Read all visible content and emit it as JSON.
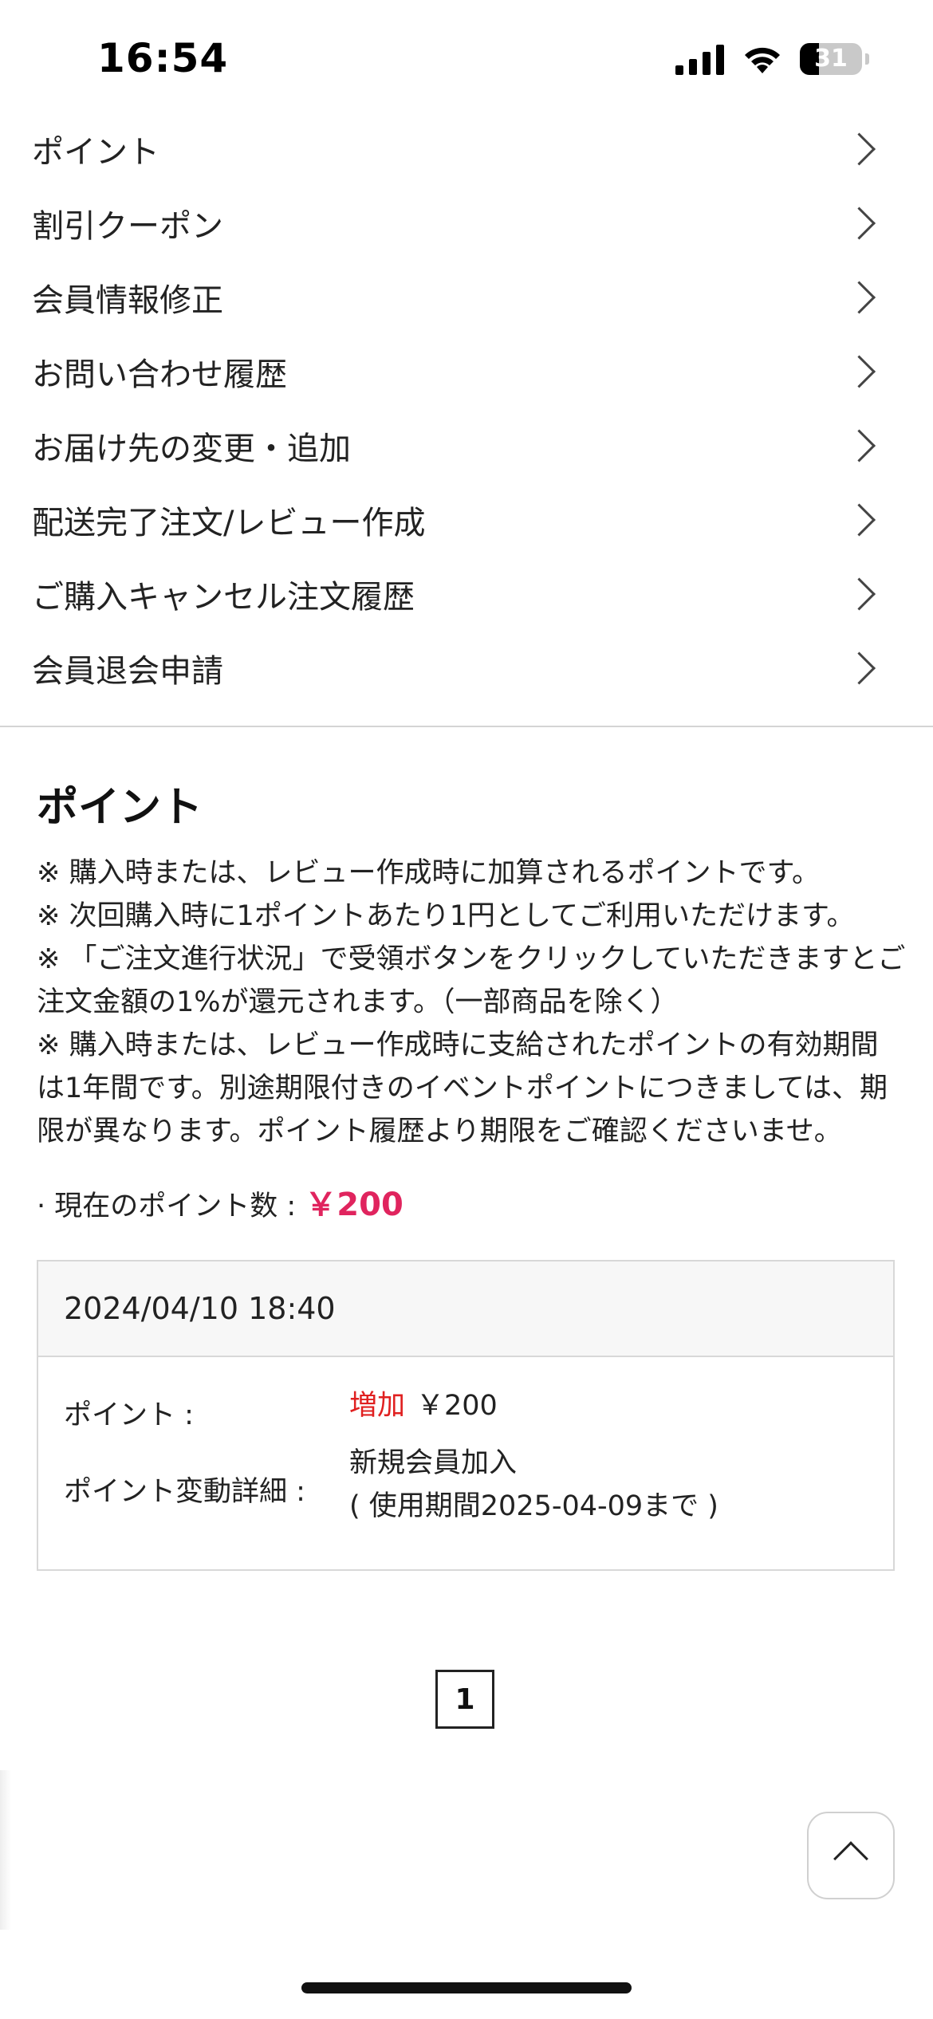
{
  "status_bar": {
    "time": "16:54",
    "battery": "31",
    "icons": [
      "signal-icon",
      "wifi-icon",
      "battery-icon"
    ]
  },
  "menu": {
    "items": [
      {
        "label": "ポイント"
      },
      {
        "label": "割引クーポン"
      },
      {
        "label": "会員情報修正"
      },
      {
        "label": "お問い合わせ履歴"
      },
      {
        "label": "お届け先の変更・追加"
      },
      {
        "label": "配送完了注文/レビュー作成"
      },
      {
        "label": "ご購入キャンセル注文履歴"
      },
      {
        "label": "会員退会申請"
      }
    ]
  },
  "points": {
    "title": "ポイント",
    "notes": [
      "※ 購入時または、レビュー作成時に加算されるポイントです。",
      "※ 次回購入時に1ポイントあたり1円としてご利用いただけます。",
      "※ 「ご注文進行状況」で受領ボタンをクリックしていただきますとご注文金額の1%が還元されます。（一部商品を除く）",
      "※ 購入時または、レビュー作成時に支給されたポイントの有効期間は1年間です。別途期限付きのイベントポイントにつきましては、期限が異なります。ポイント履歴より期限をご確認くださいませ。"
    ],
    "current_label": "· 現在のポイント数 : ",
    "current_value": "￥200",
    "accent_color": "#e0245e"
  },
  "history": {
    "date": "2024/04/10 18:40",
    "point_label": "ポイント :",
    "change_type": "増加",
    "change_amount": "￥200",
    "detail_label": "ポイント変動詳細 :",
    "detail_line1": "新規会員加入",
    "detail_line2": "( 使用期間2025-04-09まで )"
  },
  "pagination": {
    "current_page": "1"
  }
}
